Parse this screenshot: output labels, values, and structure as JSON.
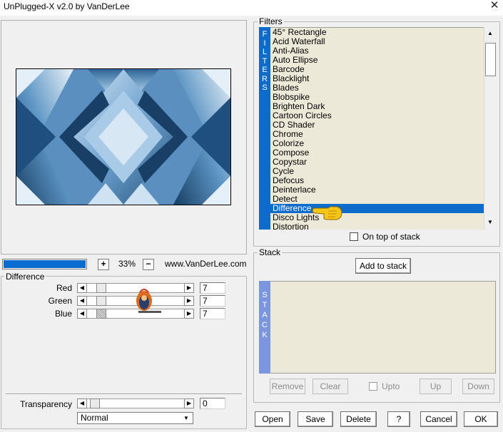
{
  "window": {
    "title": "UnPlugged-X v2.0 by VanDerLee",
    "close_glyph": "✕"
  },
  "preview": {
    "zoom": "33%",
    "plus": "+",
    "minus": "−",
    "progress_fraction": 1.0
  },
  "site": "www.VanDerLee.com",
  "params": {
    "group_label": "Difference",
    "sliders": [
      {
        "label": "Red",
        "value": "7"
      },
      {
        "label": "Green",
        "value": "7"
      },
      {
        "label": "Blue",
        "value": "7"
      }
    ],
    "transparency": {
      "label": "Transparency",
      "value": "0"
    },
    "blend_mode": "Normal"
  },
  "filters": {
    "group_label": "Filters",
    "strip_letters": [
      "F",
      "I",
      "L",
      "T",
      "E",
      "R",
      "S"
    ],
    "items": [
      "45° Rectangle",
      "Acid Waterfall",
      "Anti-Alias",
      "Auto Ellipse",
      "Barcode",
      "Blacklight",
      "Blades",
      "Blobspike",
      "Brighten Dark",
      "Cartoon Circles",
      "CD Shader",
      "Chrome",
      "Colorize",
      "Compose",
      "Copystar",
      "Cycle",
      "Defocus",
      "Deinterlace",
      "Detect",
      "Difference",
      "Disco Lights",
      "Distortion"
    ],
    "selected": "Difference",
    "on_top_label": "On top of stack"
  },
  "stack": {
    "group_label": "Stack",
    "add_label": "Add to stack",
    "strip_letters": [
      "S",
      "T",
      "A",
      "C",
      "K"
    ],
    "remove_label": "Remove",
    "clear_label": "Clear",
    "upto_label": "Upto",
    "up_label": "Up",
    "down_label": "Down"
  },
  "buttons": {
    "open": "Open",
    "save": "Save",
    "delete": "Delete",
    "help": "?",
    "cancel": "Cancel",
    "ok": "OK"
  },
  "colors": {
    "accent": "#0c6bcb",
    "list_bg": "#ece9d8",
    "stack_strip": "#7b96dd"
  }
}
